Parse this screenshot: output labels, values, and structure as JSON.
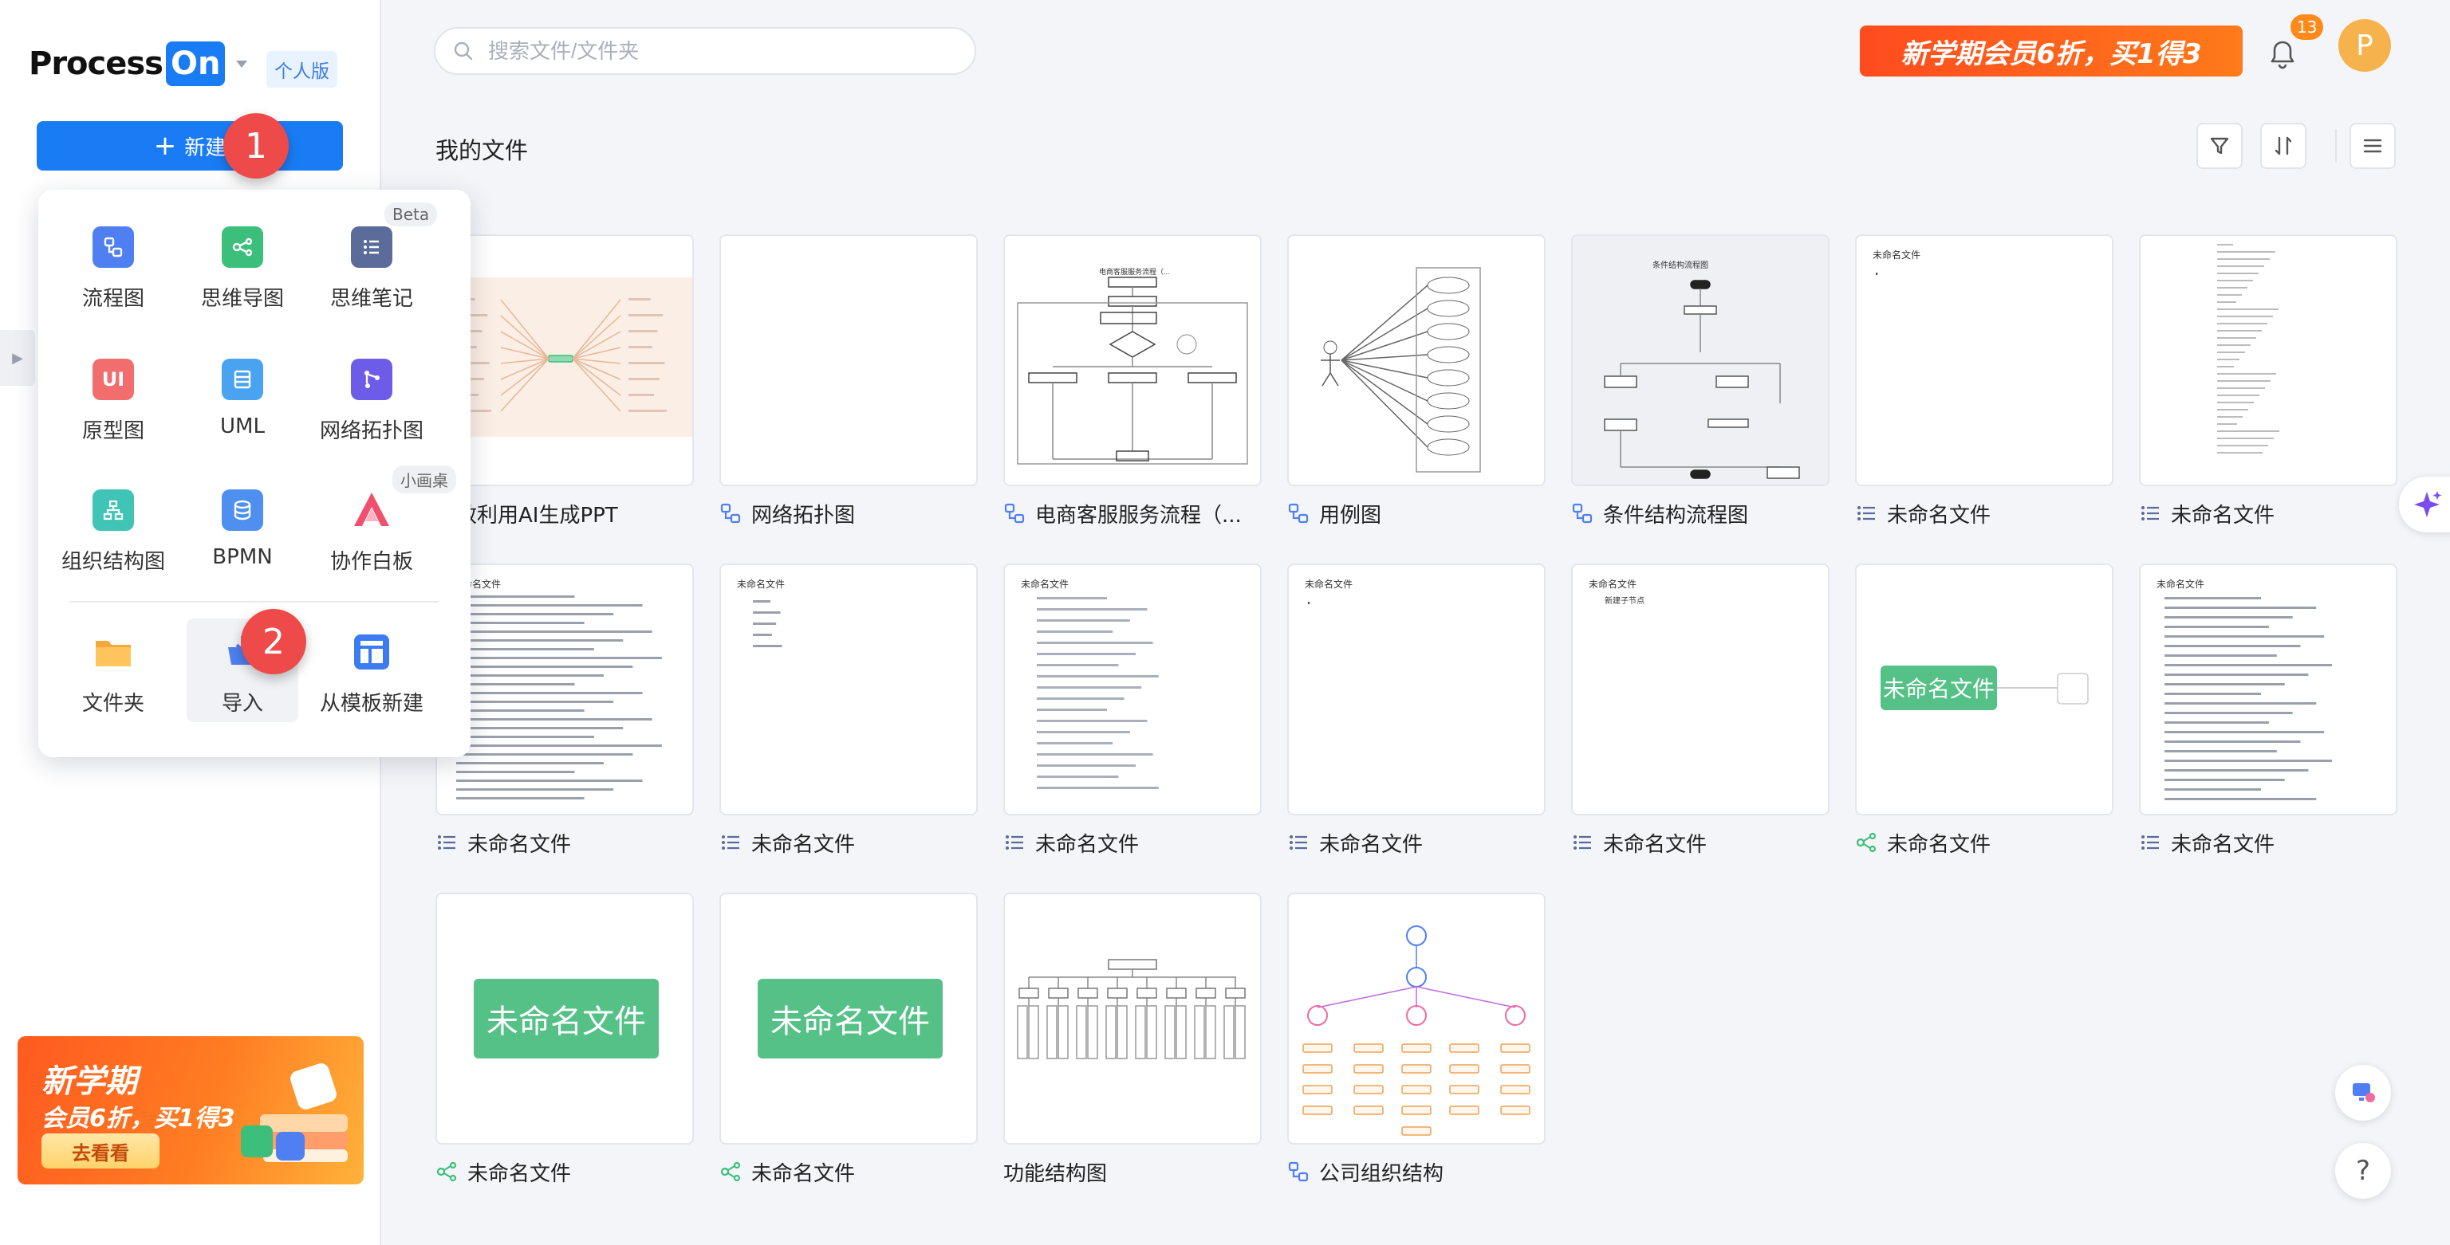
{
  "brand": {
    "name_part1": "Process",
    "name_part2": "On",
    "plan": "个人版"
  },
  "sidebar": {
    "new_button": "新建",
    "promo": {
      "line1": "新学期",
      "line2": "会员6折，买1得3",
      "button": "去看看"
    }
  },
  "steps": {
    "one": "1",
    "two": "2"
  },
  "new_menu": {
    "items": [
      {
        "label": "流程图",
        "icon": "flowchart-icon",
        "color": "#4f7ff0"
      },
      {
        "label": "思维导图",
        "icon": "mindmap-icon",
        "color": "#3cbf7a"
      },
      {
        "label": "思维笔记",
        "icon": "mind-notes-icon",
        "color": "#5b6b9a",
        "tag": "Beta"
      },
      {
        "label": "原型图",
        "icon": "prototype-icon",
        "color": "#f26d6d",
        "glyph": "UI"
      },
      {
        "label": "UML",
        "icon": "uml-icon",
        "color": "#4aa3f0"
      },
      {
        "label": "网络拓扑图",
        "icon": "network-topology-icon",
        "color": "#6d5ce8"
      },
      {
        "label": "组织结构图",
        "icon": "org-chart-icon",
        "color": "#3fc4b6"
      },
      {
        "label": "BPMN",
        "icon": "bpmn-icon",
        "color": "#4f8ff0"
      },
      {
        "label": "协作白板",
        "icon": "whiteboard-icon",
        "color": "#f0506e",
        "tag": "小画桌"
      },
      {
        "label": "文件夹",
        "icon": "folder-icon",
        "color": "#f7a83a"
      },
      {
        "label": "导入",
        "icon": "import-icon",
        "color": "#4f7ff0"
      },
      {
        "label": "从模板新建",
        "icon": "template-icon",
        "color": "#3d7cf0"
      }
    ]
  },
  "topbar": {
    "search_placeholder": "搜索文件/文件夹",
    "promo": "新学期会员6折，买1得3",
    "notifications": "13",
    "avatar_letter": "P"
  },
  "main": {
    "title": "我的文件",
    "files": [
      {
        "name": "高效利用AI生成PPT",
        "type": "none",
        "thumb": "mindmap-wide"
      },
      {
        "name": "网络拓扑图",
        "type": "flow",
        "thumb": "blank"
      },
      {
        "name": "电商客服服务流程（...",
        "type": "flow",
        "thumb": "flow"
      },
      {
        "name": "用例图",
        "type": "flow",
        "thumb": "usecase"
      },
      {
        "name": "条件结构流程图",
        "type": "flow",
        "thumb": "condflow"
      },
      {
        "name": "未命名文件",
        "type": "note",
        "thumb": "note-short",
        "text": "未命名文件"
      },
      {
        "name": "未命名文件",
        "type": "note",
        "thumb": "note-long"
      },
      {
        "name": "未命名文件",
        "type": "note",
        "thumb": "note-para",
        "text": "未命名文件"
      },
      {
        "name": "未命名文件",
        "type": "note",
        "thumb": "note-list",
        "text": "未命名文件"
      },
      {
        "name": "未命名文件",
        "type": "note",
        "thumb": "note-outline",
        "text": "未命名文件"
      },
      {
        "name": "未命名文件",
        "type": "note",
        "thumb": "note-short",
        "text": "未命名文件"
      },
      {
        "name": "未命名文件",
        "type": "note",
        "thumb": "note-sub",
        "text": "未命名文件",
        "sub": "新建子节点"
      },
      {
        "name": "未命名文件",
        "type": "mind",
        "thumb": "green-node",
        "text": "未命名文件"
      },
      {
        "name": "未命名文件",
        "type": "note",
        "thumb": "note-tree",
        "text": "未命名文件"
      },
      {
        "name": "未命名文件",
        "type": "mind",
        "thumb": "green-big",
        "text": "未命名文件"
      },
      {
        "name": "未命名文件",
        "type": "mind",
        "thumb": "green-big",
        "text": "未命名文件"
      },
      {
        "name": "功能结构图",
        "type": "none",
        "thumb": "function-tree"
      },
      {
        "name": "公司组织结构",
        "type": "flow",
        "thumb": "org-tree"
      }
    ]
  },
  "colors": {
    "accent": "#1a7cf5",
    "promo": "#ff5a1f",
    "mind_green": "#55c187",
    "badge": "#ff8a1c"
  }
}
